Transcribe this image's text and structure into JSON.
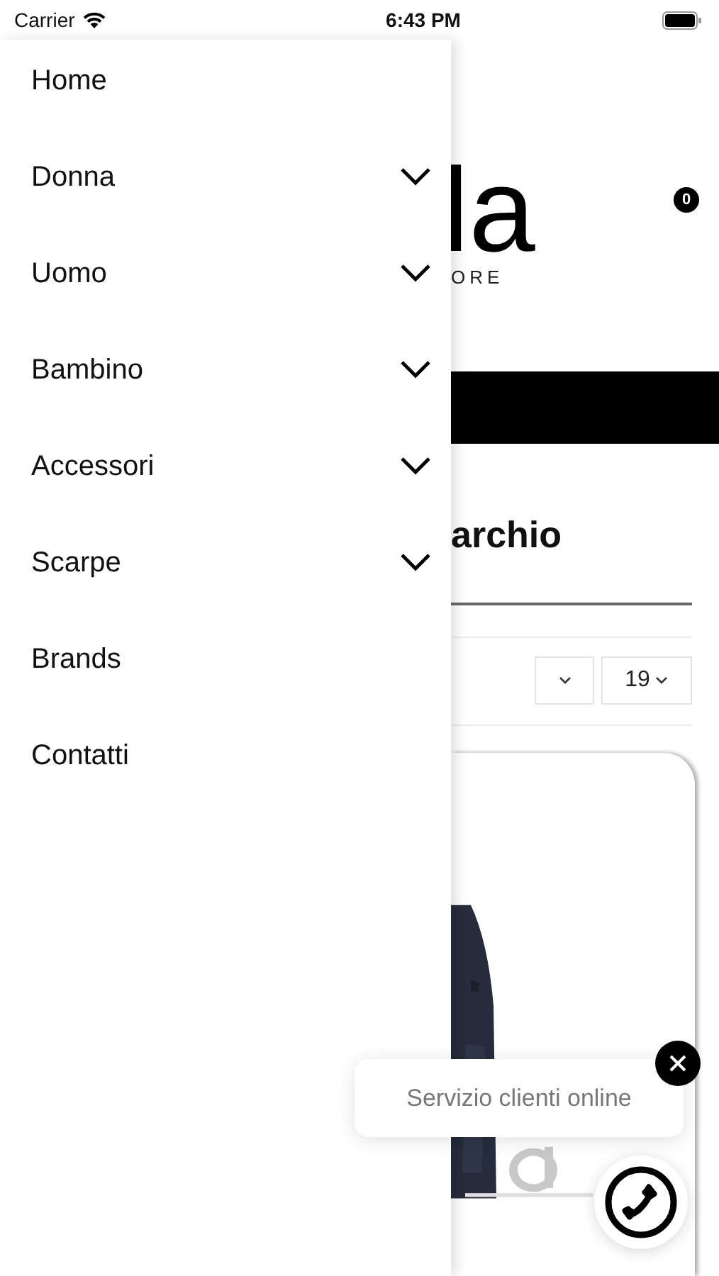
{
  "status_bar": {
    "carrier": "Carrier",
    "time": "6:43 PM"
  },
  "menu": [
    {
      "label": "Home",
      "expandable": false
    },
    {
      "label": "Donna",
      "expandable": true
    },
    {
      "label": "Uomo",
      "expandable": true
    },
    {
      "label": "Bambino",
      "expandable": true
    },
    {
      "label": "Accessori",
      "expandable": true
    },
    {
      "label": "Scarpe",
      "expandable": true
    },
    {
      "label": "Brands",
      "expandable": false
    },
    {
      "label": "Contatti",
      "expandable": false
    }
  ],
  "page": {
    "logo_letters": "la",
    "logo_tagline": "ORE",
    "cart_count": "0",
    "heading": "archio",
    "per_page_select": "19"
  },
  "chat": {
    "message": "Servizio clienti online"
  }
}
